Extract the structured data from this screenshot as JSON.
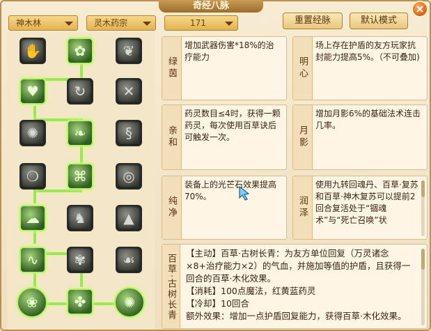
{
  "window": {
    "title": "奇经八脉",
    "close_label": "×"
  },
  "filters": {
    "school": "神木林",
    "faction": "灵木药宗",
    "level": "171"
  },
  "toolbar": {
    "reset_label": "重置经脉",
    "default_label": "默认模式"
  },
  "tree": {
    "nodes": [
      {
        "name": "node-1-1",
        "icon": "hand-leaf-icon",
        "glyph": "✋",
        "active": false
      },
      {
        "name": "node-1-2",
        "icon": "sprout-icon",
        "glyph": "✿",
        "active": true
      },
      {
        "name": "node-1-3",
        "icon": "leaf-cluster-icon",
        "glyph": "❦",
        "active": false
      },
      {
        "name": "node-2-1",
        "icon": "heart-icon",
        "glyph": "♥",
        "active": true
      },
      {
        "name": "node-2-2",
        "icon": "swirl-icon",
        "glyph": "↻",
        "active": false
      },
      {
        "name": "node-2-3",
        "icon": "crossed-tools-icon",
        "glyph": "✕",
        "active": false
      },
      {
        "name": "node-3-1",
        "icon": "bomb-icon",
        "glyph": "✺",
        "active": false
      },
      {
        "name": "node-3-2",
        "icon": "flame-leaf-icon",
        "glyph": "❧",
        "active": true
      },
      {
        "name": "node-3-3",
        "icon": "wave-icon",
        "glyph": "§",
        "active": false
      },
      {
        "name": "node-4-1",
        "icon": "wreath-icon",
        "glyph": "❍",
        "active": false
      },
      {
        "name": "node-4-2",
        "icon": "vine-icon",
        "glyph": "⌘",
        "active": true
      },
      {
        "name": "node-4-3",
        "icon": "spiral-icon",
        "glyph": "◎",
        "active": false
      },
      {
        "name": "node-5-1",
        "icon": "cloud-icon",
        "glyph": "☁",
        "active": true
      },
      {
        "name": "node-5-2",
        "icon": "rabbit-icon",
        "glyph": "♞",
        "active": false
      },
      {
        "name": "node-5-3",
        "icon": "peak-icon",
        "glyph": "▲",
        "active": false
      },
      {
        "name": "node-6-1",
        "icon": "serpent-icon",
        "glyph": "∿",
        "active": true
      },
      {
        "name": "node-6-2",
        "icon": "fern-icon",
        "glyph": "✾",
        "active": false
      },
      {
        "name": "node-6-3",
        "icon": "open-hand-icon",
        "glyph": "☙",
        "active": false
      },
      {
        "name": "node-7-1",
        "icon": "orb-leaf-icon",
        "glyph": "❀",
        "active": true
      },
      {
        "name": "node-7-2",
        "icon": "tree-seed-icon",
        "glyph": "✤",
        "active": true
      },
      {
        "name": "node-7-3",
        "icon": "vortex-icon",
        "glyph": "✺",
        "active": true
      }
    ]
  },
  "cards": [
    {
      "name": "绿茵",
      "desc": "增加武器伤害*18%的治疗能力"
    },
    {
      "name": "明心",
      "desc": "场上存在护盾的友方玩家抗封能力提高5%。（不可叠加)"
    },
    {
      "name": "亲和",
      "desc": "药灵数目≤4时，获得一颗药灵，每次使用百草诀后可触发一次。"
    },
    {
      "name": "月影",
      "desc": "增加月影6%的基础法术连击几率。"
    },
    {
      "name": "纯净",
      "desc": "装备上的光芒石效果提高70%。"
    },
    {
      "name": "润泽",
      "desc": "使用九转回魂丹、百草·复苏和百草·神木复苏可以提前2回合复活处于“锢魂术”与“死亡召唤”状"
    }
  ],
  "detail": {
    "name": "百草·古树长青",
    "lines": [
      "【主动】百草·古树长青：为友方单位回复（万灵诸念×8+治疗能力×2）的气血，并施加等值的护盾，且获得一回合的百草·木化效果。",
      "【消耗】100点魔法，红黄蓝药灵",
      "【冷却】10回合",
      "额外效果：增加一点护盾回复能力，获得百草·木化效果。"
    ]
  },
  "colors": {
    "accent": "#9fe35c",
    "tag": "#9c2f12",
    "frame": "#b98f52"
  }
}
